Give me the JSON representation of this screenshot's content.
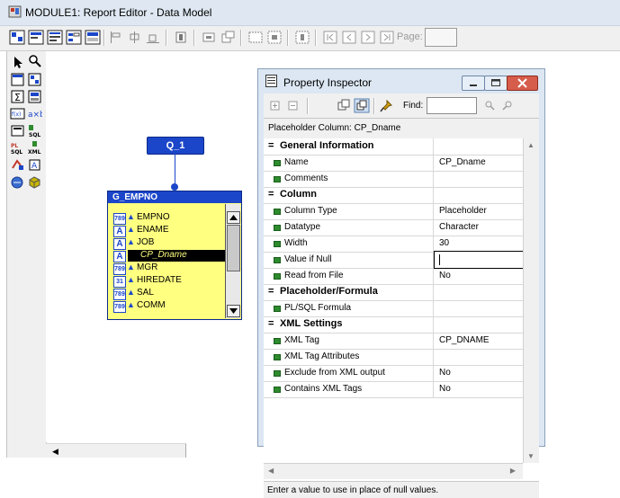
{
  "window": {
    "title": "MODULE1: Report Editor - Data Model"
  },
  "toolbar": {
    "page_label": "Page:",
    "page_value": ""
  },
  "query": {
    "name": "Q_1"
  },
  "group": {
    "name": "G_EMPNO",
    "columns": [
      {
        "icon": "789",
        "label": "EMPNO"
      },
      {
        "icon": "A",
        "label": "ENAME"
      },
      {
        "icon": "A",
        "label": "JOB"
      },
      {
        "icon": "A",
        "label": "CP_Dname"
      },
      {
        "icon": "789",
        "label": "MGR"
      },
      {
        "icon": "31",
        "label": "HIREDATE"
      },
      {
        "icon": "789",
        "label": "SAL"
      },
      {
        "icon": "789",
        "label": "COMM"
      }
    ]
  },
  "inspector": {
    "title": "Property Inspector",
    "find_label": "Find:",
    "find_value": "",
    "object_header": "Placeholder Column: CP_Dname",
    "rows": [
      {
        "type": "section",
        "symbol": "=",
        "label": "General Information",
        "value": ""
      },
      {
        "type": "prop",
        "label": "Name",
        "value": "CP_Dname"
      },
      {
        "type": "prop",
        "label": "Comments",
        "value": ""
      },
      {
        "type": "section",
        "symbol": "=",
        "label": "Column",
        "value": ""
      },
      {
        "type": "prop",
        "label": "Column Type",
        "value": "Placeholder"
      },
      {
        "type": "prop",
        "label": "Datatype",
        "value": "Character"
      },
      {
        "type": "prop",
        "label": "Width",
        "value": "30"
      },
      {
        "type": "prop",
        "label": "Value if Null",
        "value": ""
      },
      {
        "type": "prop",
        "label": "Read from File",
        "value": "No"
      },
      {
        "type": "section",
        "symbol": "=",
        "label": "Placeholder/Formula",
        "value": ""
      },
      {
        "type": "prop",
        "label": "PL/SQL Formula",
        "value": ""
      },
      {
        "type": "section",
        "symbol": "=",
        "label": "XML Settings",
        "value": ""
      },
      {
        "type": "prop",
        "label": "XML Tag",
        "value": "CP_DNAME"
      },
      {
        "type": "prop",
        "label": "XML Tag Attributes",
        "value": ""
      },
      {
        "type": "prop",
        "label": "Exclude from XML output",
        "value": "No"
      },
      {
        "type": "prop",
        "label": "Contains XML Tags",
        "value": "No"
      }
    ],
    "status_text": "Enter a value to use in place of null values."
  }
}
